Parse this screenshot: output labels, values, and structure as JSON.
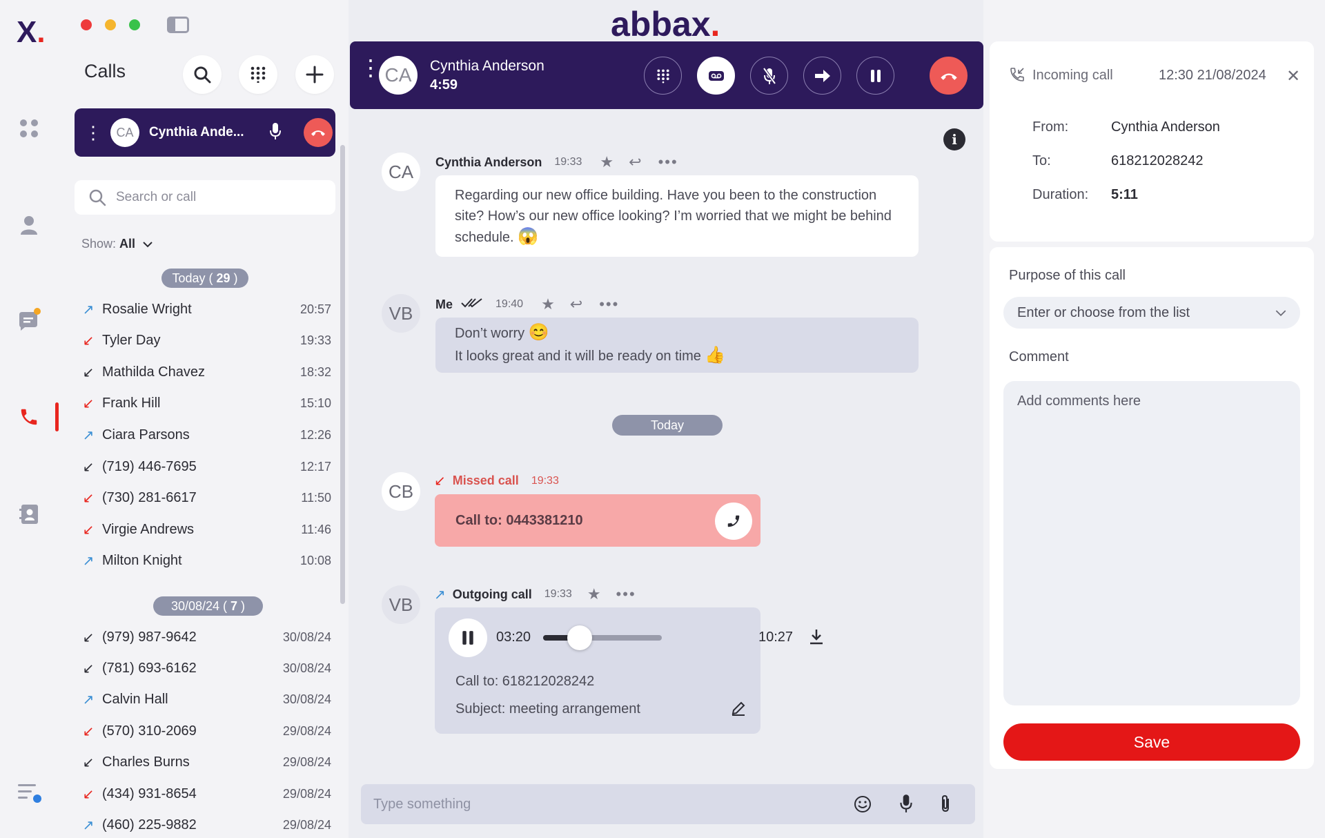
{
  "app": {
    "logo_text": "X",
    "brand": "abbax"
  },
  "calls_panel": {
    "title": "Calls",
    "active_call": {
      "initials": "CA",
      "name": "Cynthia Ande..."
    },
    "search_placeholder": "Search or call",
    "show_label": "Show:",
    "show_value": "All",
    "groups": [
      {
        "label": "Today",
        "count": "29"
      },
      {
        "label": "30/08/24",
        "count": "7"
      }
    ],
    "today_calls": [
      {
        "name": "Rosalie Wright",
        "time": "20:57",
        "direction": "outgoing",
        "color": "#3b8fd4"
      },
      {
        "name": "Tyler Day",
        "time": "19:33",
        "direction": "missed",
        "color": "#e8261f"
      },
      {
        "name": "Mathilda Chavez",
        "time": "18:32",
        "direction": "incoming",
        "color": "#2b2b33"
      },
      {
        "name": "Frank Hill",
        "time": "15:10",
        "direction": "missed",
        "color": "#e8261f"
      },
      {
        "name": "Ciara Parsons",
        "time": "12:26",
        "direction": "outgoing",
        "color": "#3b8fd4"
      },
      {
        "name": "(719) 446-7695",
        "time": "12:17",
        "direction": "incoming",
        "color": "#2b2b33"
      },
      {
        "name": "(730) 281-6617",
        "time": "11:50",
        "direction": "missed",
        "color": "#e8261f"
      },
      {
        "name": "Virgie Andrews",
        "time": "11:46",
        "direction": "missed",
        "color": "#e8261f"
      },
      {
        "name": "Milton Knight",
        "time": "10:08",
        "direction": "outgoing",
        "color": "#3b8fd4"
      }
    ],
    "older_calls": [
      {
        "name": "(979) 987-9642",
        "time": "30/08/24",
        "direction": "incoming",
        "color": "#2b2b33"
      },
      {
        "name": "(781) 693-6162",
        "time": "30/08/24",
        "direction": "incoming",
        "color": "#2b2b33"
      },
      {
        "name": "Calvin Hall",
        "time": "30/08/24",
        "direction": "outgoing",
        "color": "#3b8fd4"
      },
      {
        "name": "(570) 310-2069",
        "time": "29/08/24",
        "direction": "missed",
        "color": "#e8261f"
      },
      {
        "name": "Charles Burns",
        "time": "29/08/24",
        "direction": "incoming",
        "color": "#2b2b33"
      },
      {
        "name": "(434) 931-8654",
        "time": "29/08/24",
        "direction": "missed",
        "color": "#e8261f"
      },
      {
        "name": "(460) 225-9882",
        "time": "29/08/24",
        "direction": "outgoing",
        "color": "#3b8fd4"
      }
    ]
  },
  "call_bar": {
    "initials": "CA",
    "name": "Cynthia Anderson",
    "duration": "4:59"
  },
  "chat": {
    "messages": [
      {
        "initials": "CA",
        "sender": "Cynthia Anderson",
        "time": "19:33",
        "text": "Regarding our new office building. Have you been to the construction site? How’s our new office looking? I’m worried that we might be behind schedule.",
        "emoji": "😱"
      },
      {
        "initials": "VB",
        "sender": "Me",
        "time": "19:40",
        "line1": "Don’t worry",
        "emoji1": "😊",
        "line2": "It looks great and it will be ready on time",
        "emoji2": "👍"
      }
    ],
    "day_divider": "Today",
    "missed_call": {
      "initials": "CB",
      "label": "Missed call",
      "time": "19:33",
      "text": "Call to: 0443381210"
    },
    "outgoing_call": {
      "initials": "VB",
      "label": "Outgoing call",
      "time": "19:33",
      "elapsed": "03:20",
      "total": "10:27",
      "progress": 0.31,
      "call_to": "Call to: 618212028242",
      "subject": "Subject: meeting arrangement"
    },
    "input_placeholder": "Type something"
  },
  "details": {
    "header": "Incoming call",
    "datetime": "12:30 21/08/2024",
    "from_label": "From:",
    "from_value": "Cynthia Anderson",
    "to_label": "To:",
    "to_value": "618212028242",
    "duration_label": "Duration:",
    "duration_value": "5:11"
  },
  "form": {
    "purpose_label": "Purpose of this call",
    "purpose_placeholder": "Enter or choose from the list",
    "comment_label": "Comment",
    "comment_placeholder": "Add comments here",
    "save_label": "Save"
  },
  "colors": {
    "primary": "#2d1a5b",
    "accent_red": "#e8261f",
    "missed_bg": "#f7a8a8",
    "pill": "#8e93a9"
  }
}
